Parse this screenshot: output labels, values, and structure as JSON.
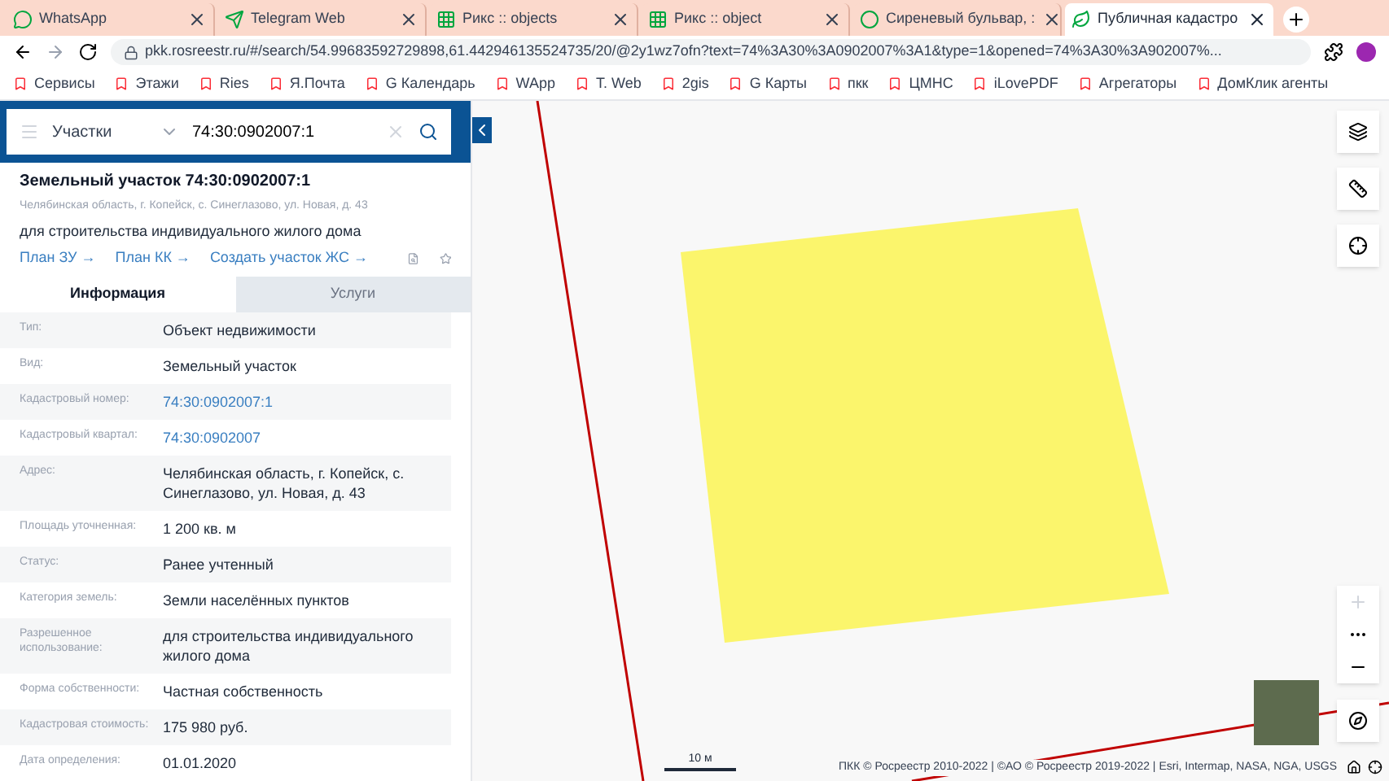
{
  "browser": {
    "tabs": [
      {
        "label": "WhatsApp",
        "selected": false
      },
      {
        "label": "Telegram Web",
        "selected": false
      },
      {
        "label": "Рикс :: objects",
        "selected": false
      },
      {
        "label": "Рикс :: object",
        "selected": false
      },
      {
        "label": "Сиреневый бульвар, :",
        "selected": false
      },
      {
        "label": "Публичная кадастро",
        "selected": true
      }
    ],
    "url": "pkk.rosreestr.ru/#/search/54.99683592729898,61.442946135524735/20/@2y1wz7ofn?text=74%3A30%3A0902007%3A1&type=1&opened=74%3A30%3A902007%...",
    "bookmarks": [
      "Сервисы",
      "Этажи",
      "Ries",
      "Я.Почта",
      "G Календарь",
      "WApp",
      "T. Web",
      "2gis",
      "G Карты",
      "пкк",
      "ЦМНС",
      "iLovePDF",
      "Агрегаторы",
      "ДомКлик агенты"
    ]
  },
  "search": {
    "category": "Участки",
    "value": "74:30:0902007:1"
  },
  "object": {
    "title": "Земельный участок 74:30:0902007:1",
    "address": "Челябинская область, г. Копейск, с. Синеглазово, ул. Новая, д. 43",
    "purpose": "для строительства индивидуального жилого дома",
    "links": [
      "План ЗУ →",
      "План КК →",
      "Создать участок ЖС →"
    ]
  },
  "panel_tabs": [
    {
      "label": "Информация",
      "selected": true
    },
    {
      "label": "Услуги",
      "selected": false
    }
  ],
  "rows": [
    {
      "label": "Тип:",
      "value": "Объект недвижимости",
      "kind": "text"
    },
    {
      "label": "Вид:",
      "value": "Земельный участок",
      "kind": "text"
    },
    {
      "label": "Кадастровый номер:",
      "value": "74:30:0902007:1",
      "kind": "link"
    },
    {
      "label": "Кадастровый квартал:",
      "value": "74:30:0902007",
      "kind": "link"
    },
    {
      "label": "Адрес:",
      "value": "Челябинская область, г. Копейск, с. Синеглазово, ул. Новая, д. 43",
      "kind": "text"
    },
    {
      "label": "Площадь уточненная:",
      "value": "1 200 кв. м",
      "kind": "text"
    },
    {
      "label": "Статус:",
      "value": "Ранее учтенный",
      "kind": "text"
    },
    {
      "label": "Категория земель:",
      "value": "Земли населённых пунктов",
      "kind": "text"
    },
    {
      "label": "Разрешенное использование:",
      "value": "для строительства индивидуального жилого дома",
      "kind": "text"
    },
    {
      "label": "Форма собственности:",
      "value": "Частная собственность",
      "kind": "text"
    },
    {
      "label": "Кадастровая стоимость:",
      "value": "175 980 руб.",
      "kind": "text"
    },
    {
      "label": "Дата определения:",
      "value": "01.01.2020",
      "kind": "text"
    }
  ],
  "map": {
    "scale": "10 м",
    "attribution": "ПКК © Росреестр 2010-2022 | ©АО © Росреестр 2019-2022 | Esri, Intermap, NASA, NGA, USGS"
  }
}
